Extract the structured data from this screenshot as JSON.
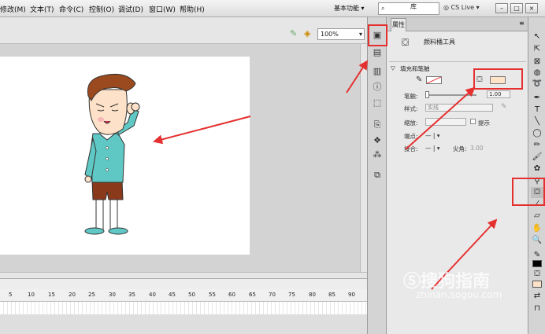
{
  "menubar": {
    "items": [
      "修改(M)",
      "文本(T)",
      "命令(C)",
      "控制(O)",
      "调试(D)",
      "窗口(W)",
      "帮助(H)"
    ],
    "workspace": "基本功能",
    "search_placeholder": "",
    "cs_live": "CS Live"
  },
  "stage": {
    "zoom": "100%"
  },
  "timeline": {
    "ticks": [
      "5",
      "10",
      "15",
      "20",
      "25",
      "30",
      "35",
      "40",
      "45",
      "50",
      "55",
      "60",
      "65",
      "70",
      "75",
      "80",
      "85",
      "90"
    ]
  },
  "properties": {
    "tabs": [
      "属性",
      "库"
    ],
    "tool_name": "颜料桶工具",
    "section_fill_stroke": "填充和笔触",
    "stroke_label": "笔触:",
    "stroke_value": "1.00",
    "style_label": "样式:",
    "style_value": "实线",
    "scale_label": "缩放:",
    "hint_label": "提示",
    "cap_label": "端点:",
    "join_label": "接合:",
    "miter_label": "尖角:",
    "miter_value": "3.00",
    "fill_color": "#ffe3c8"
  },
  "watermark": {
    "text": "搜狗指南",
    "url": "zhinan.sogou.com"
  },
  "colors": {
    "highlight": "#e53030",
    "character_shirt": "#5fc8c4",
    "character_hair": "#9a4a1e"
  }
}
